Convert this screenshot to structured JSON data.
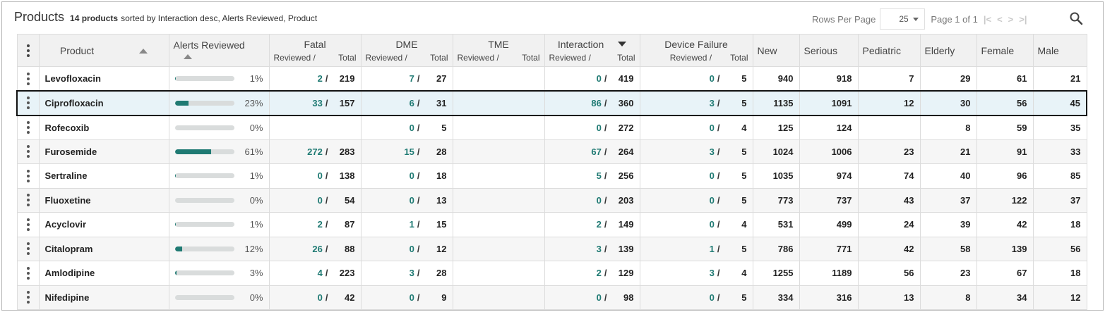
{
  "header": {
    "title": "Products",
    "count_label": "14 products",
    "sorted_label": "sorted by Interaction desc, Alerts Reviewed, Product"
  },
  "pager": {
    "rows_per_page_label": "Rows Per Page",
    "rows_per_page_value": "25",
    "page_info": "Page 1 of 1",
    "first_icon": "first-page-icon",
    "prev_icon": "prev-page-icon",
    "next_icon": "next-page-icon",
    "last_icon": "last-page-icon"
  },
  "columns": {
    "product": "Product",
    "alerts_reviewed": "Alerts Reviewed",
    "fatal": "Fatal",
    "dme": "DME",
    "tme": "TME",
    "interaction": "Interaction",
    "device_failure": "Device Failure",
    "reviewed_sub": "Reviewed /",
    "total_sub": "Total",
    "new": "New",
    "serious": "Serious",
    "pediatric": "Pediatric",
    "elderly": "Elderly",
    "female": "Female",
    "male": "Male"
  },
  "colors": {
    "accent": "#1f7a73",
    "selected_row": "#e8f3f8"
  },
  "rows": [
    {
      "product": "Levofloxacin",
      "pct": "1%",
      "frac": 0.01,
      "fatal_r": "2",
      "fatal_t": "219",
      "dme_r": "7",
      "dme_t": "27",
      "tme_r": "",
      "tme_t": "",
      "int_r": "0",
      "int_t": "419",
      "dev_r": "0",
      "dev_t": "5",
      "new": "940",
      "serious": "918",
      "pediatric": "7",
      "elderly": "29",
      "female": "61",
      "male": "21"
    },
    {
      "product": "Ciprofloxacin",
      "pct": "23%",
      "frac": 0.23,
      "fatal_r": "33",
      "fatal_t": "157",
      "dme_r": "6",
      "dme_t": "31",
      "tme_r": "",
      "tme_t": "",
      "int_r": "86",
      "int_t": "360",
      "dev_r": "3",
      "dev_t": "5",
      "new": "1135",
      "serious": "1091",
      "pediatric": "12",
      "elderly": "30",
      "female": "56",
      "male": "45",
      "selected": true
    },
    {
      "product": "Rofecoxib",
      "pct": "0%",
      "frac": 0,
      "fatal_r": "",
      "fatal_t": "",
      "dme_r": "0",
      "dme_t": "5",
      "tme_r": "",
      "tme_t": "",
      "int_r": "0",
      "int_t": "272",
      "dev_r": "0",
      "dev_t": "4",
      "new": "125",
      "serious": "124",
      "pediatric": "",
      "elderly": "8",
      "female": "59",
      "male": "35"
    },
    {
      "product": "Furosemide",
      "pct": "61%",
      "frac": 0.61,
      "fatal_r": "272",
      "fatal_t": "283",
      "dme_r": "15",
      "dme_t": "28",
      "tme_r": "",
      "tme_t": "",
      "int_r": "67",
      "int_t": "264",
      "dev_r": "3",
      "dev_t": "5",
      "new": "1024",
      "serious": "1006",
      "pediatric": "23",
      "elderly": "21",
      "female": "91",
      "male": "33"
    },
    {
      "product": "Sertraline",
      "pct": "1%",
      "frac": 0.01,
      "fatal_r": "0",
      "fatal_t": "138",
      "dme_r": "0",
      "dme_t": "18",
      "tme_r": "",
      "tme_t": "",
      "int_r": "5",
      "int_t": "256",
      "dev_r": "0",
      "dev_t": "5",
      "new": "1035",
      "serious": "974",
      "pediatric": "74",
      "elderly": "40",
      "female": "96",
      "male": "85"
    },
    {
      "product": "Fluoxetine",
      "pct": "0%",
      "frac": 0,
      "fatal_r": "0",
      "fatal_t": "54",
      "dme_r": "0",
      "dme_t": "13",
      "tme_r": "",
      "tme_t": "",
      "int_r": "0",
      "int_t": "203",
      "dev_r": "0",
      "dev_t": "5",
      "new": "773",
      "serious": "737",
      "pediatric": "43",
      "elderly": "37",
      "female": "122",
      "male": "37"
    },
    {
      "product": "Acyclovir",
      "pct": "1%",
      "frac": 0.01,
      "fatal_r": "2",
      "fatal_t": "87",
      "dme_r": "1",
      "dme_t": "15",
      "tme_r": "",
      "tme_t": "",
      "int_r": "2",
      "int_t": "149",
      "dev_r": "0",
      "dev_t": "4",
      "new": "531",
      "serious": "499",
      "pediatric": "24",
      "elderly": "39",
      "female": "42",
      "male": "18"
    },
    {
      "product": "Citalopram",
      "pct": "12%",
      "frac": 0.12,
      "fatal_r": "26",
      "fatal_t": "88",
      "dme_r": "0",
      "dme_t": "12",
      "tme_r": "",
      "tme_t": "",
      "int_r": "3",
      "int_t": "139",
      "dev_r": "1",
      "dev_t": "5",
      "new": "786",
      "serious": "771",
      "pediatric": "42",
      "elderly": "58",
      "female": "139",
      "male": "56"
    },
    {
      "product": "Amlodipine",
      "pct": "3%",
      "frac": 0.03,
      "fatal_r": "4",
      "fatal_t": "223",
      "dme_r": "3",
      "dme_t": "28",
      "tme_r": "",
      "tme_t": "",
      "int_r": "2",
      "int_t": "129",
      "dev_r": "3",
      "dev_t": "4",
      "new": "1255",
      "serious": "1189",
      "pediatric": "56",
      "elderly": "23",
      "female": "67",
      "male": "18"
    },
    {
      "product": "Nifedipine",
      "pct": "0%",
      "frac": 0,
      "fatal_r": "0",
      "fatal_t": "42",
      "dme_r": "0",
      "dme_t": "9",
      "tme_r": "",
      "tme_t": "",
      "int_r": "0",
      "int_t": "98",
      "dev_r": "0",
      "dev_t": "5",
      "new": "334",
      "serious": "316",
      "pediatric": "13",
      "elderly": "8",
      "female": "34",
      "male": "12"
    }
  ]
}
